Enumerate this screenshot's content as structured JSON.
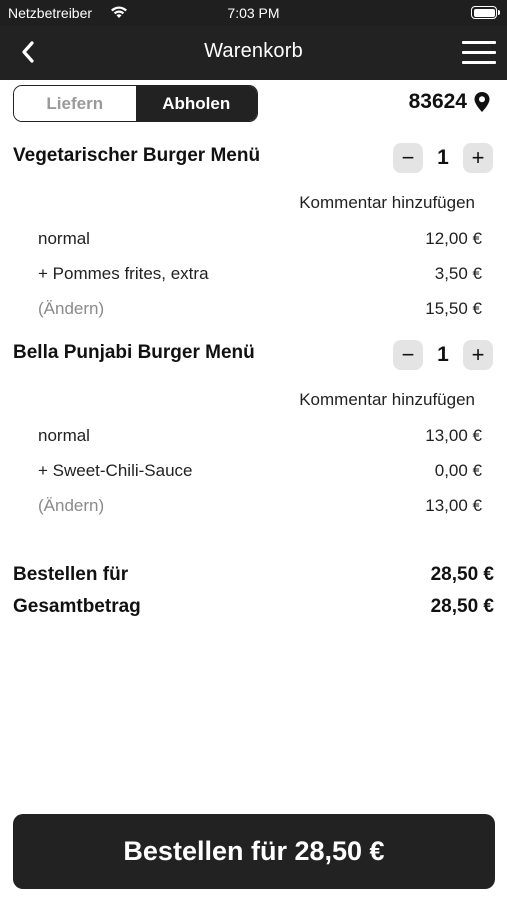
{
  "status": {
    "carrier": "Netzbetreiber",
    "time": "7:03 PM"
  },
  "nav": {
    "title": "Warenkorb"
  },
  "mode": {
    "deliver_label": "Liefern",
    "pickup_label": "Abholen",
    "selected": "Abholen"
  },
  "location": {
    "zip": "83624"
  },
  "items": [
    {
      "name": "Vegetarischer Burger Menü",
      "quantity": "1",
      "comment_label": "Kommentar hinzufügen",
      "lines": [
        {
          "label": "normal",
          "price": "12,00 €"
        },
        {
          "label": "+ Pommes frites, extra",
          "price": "3,50 €"
        }
      ],
      "edit_label": "(Ändern)",
      "subtotal": "15,50 €"
    },
    {
      "name": "Bella Punjabi Burger Menü",
      "quantity": "1",
      "comment_label": "Kommentar hinzufügen",
      "lines": [
        {
          "label": "normal",
          "price": "13,00 €"
        },
        {
          "label": "+ Sweet-Chili-Sauce",
          "price": "0,00 €"
        }
      ],
      "edit_label": "(Ändern)",
      "subtotal": "13,00 €"
    }
  ],
  "summary": {
    "order_for_label": "Bestellen für",
    "order_for_value": "28,50 €",
    "total_label": "Gesamtbetrag",
    "total_value": "28,50 €"
  },
  "order_button": {
    "label": "Bestellen für 28,50 €"
  },
  "colors": {
    "dark": "#222222",
    "muted": "#8a8a8a",
    "stepper_bg": "#e4e4e4"
  }
}
